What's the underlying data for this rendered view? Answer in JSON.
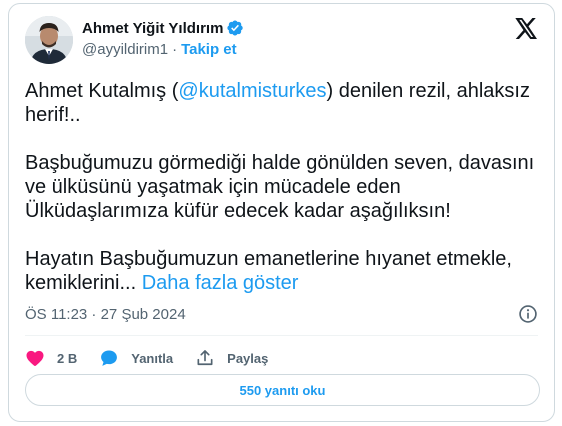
{
  "author": {
    "display_name": "Ahmet Yiğit Yıldırım",
    "handle": "@ayyildirim1",
    "separator": "·",
    "follow_label": "Takip et",
    "verified": true,
    "verified_color": "#1d9bf0"
  },
  "tweet": {
    "line1_prefix": "Ahmet Kutalmış (",
    "mention": "@kutalmisturkes",
    "line1_suffix": ") denilen rezil, ahlaksız herif!..",
    "paragraph2": "Başbuğumuzu görmediği halde gönülden seven, davasını ve ülküsünü yaşatmak için mücadele eden Ülküdaşlarımıza küfür edecek kadar aşağılıksın!",
    "paragraph3": "Hayatın Başbuğumuzun emanetlerine hıyanet etmekle, kemiklerini...",
    "show_more": "Daha fazla göster"
  },
  "timestamp": "ÖS 11:23 · 27 Şub 2024",
  "actions": {
    "likes": "2 B",
    "reply_label": "Yanıtla",
    "share_label": "Paylaş"
  },
  "read_replies": "550 yanıtı oku",
  "colors": {
    "accent": "#1d9bf0",
    "like": "#f91880",
    "muted": "#536471",
    "text": "#0f1419"
  },
  "icons": [
    "verified-badge-icon",
    "x-logo-icon",
    "info-icon",
    "heart-icon",
    "reply-bubble-icon",
    "share-icon"
  ]
}
